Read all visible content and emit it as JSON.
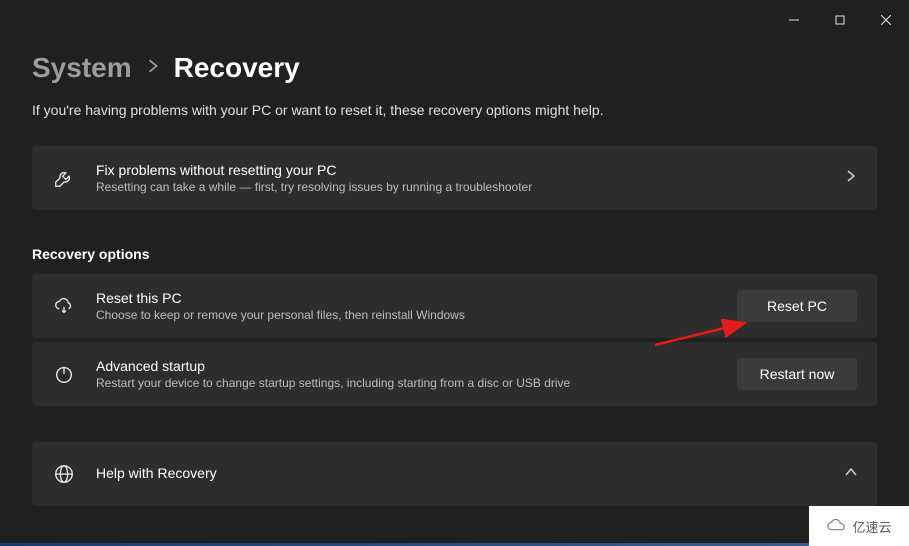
{
  "breadcrumb": {
    "parent": "System",
    "current": "Recovery"
  },
  "intro": "If you're having problems with your PC or want to reset it, these recovery options might help.",
  "troubleshooter": {
    "title": "Fix problems without resetting your PC",
    "desc": "Resetting can take a while — first, try resolving issues by running a troubleshooter"
  },
  "section_header": "Recovery options",
  "reset_pc": {
    "title": "Reset this PC",
    "desc": "Choose to keep or remove your personal files, then reinstall Windows",
    "button": "Reset PC"
  },
  "advanced_startup": {
    "title": "Advanced startup",
    "desc": "Restart your device to change startup settings, including starting from a disc or USB drive",
    "button": "Restart now"
  },
  "help": {
    "title": "Help with Recovery"
  },
  "watermark": "亿速云"
}
